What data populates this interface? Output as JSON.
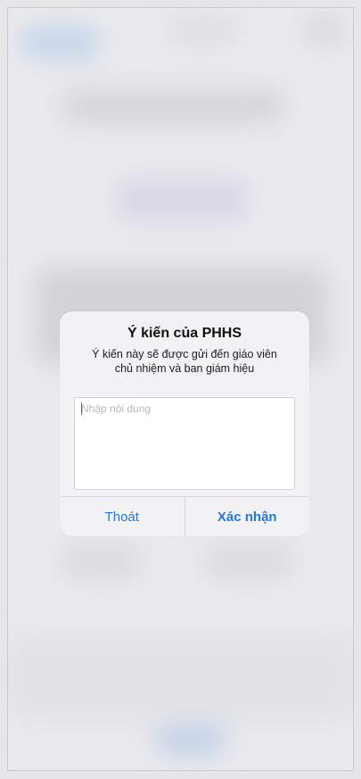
{
  "dialog": {
    "title": "Ý kiến của PHHS",
    "message_line1": "Ý kiến này sẽ được gửi đến giáo viên",
    "message_line2": "chủ nhiệm và ban giám hiệu",
    "input": {
      "placeholder": "Nhập nội dung",
      "value": ""
    },
    "buttons": {
      "cancel_label": "Thoát",
      "confirm_label": "Xác nhận"
    }
  },
  "colors": {
    "accent": "#1f7ad8",
    "background": "#ebebee",
    "dialog_background": "#f2f2f4"
  }
}
